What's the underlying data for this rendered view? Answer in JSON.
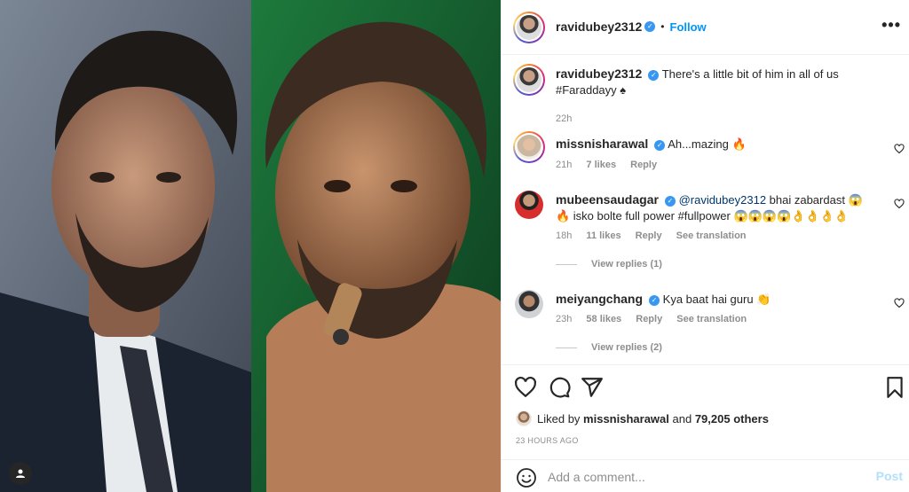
{
  "post": {
    "author": "ravidubey2312",
    "follow_label": "Follow",
    "dot": "•",
    "more_icon": "more-horizontal-icon",
    "caption_text": "There's a little bit of him in all of us #Faraddayy ♠",
    "caption_time": "22h"
  },
  "comments": [
    {
      "username": "missnisharawal",
      "verified": true,
      "text": "Ah...mazing 🔥",
      "time": "21h",
      "likes": "7 likes",
      "reply": "Reply"
    },
    {
      "username": "mubeensaudagar",
      "verified": true,
      "mention": "@ravidubey2312",
      "text": " bhai zabardast 😱 🔥 isko bolte full power #fullpower 😱😱😱😱👌👌👌👌",
      "time": "18h",
      "likes": "11 likes",
      "reply": "Reply",
      "translate": "See translation",
      "view_replies": "View replies (1)"
    },
    {
      "username": "meiyangchang",
      "verified": true,
      "text": "Kya baat hai guru 👏",
      "time": "23h",
      "likes": "58 likes",
      "reply": "Reply",
      "translate": "See translation",
      "view_replies": "View replies (2)"
    }
  ],
  "actions": {
    "liked_by_prefix": "Liked by",
    "liked_by_user": "missnisharawal",
    "liked_by_and": "and",
    "liked_by_count": "79,205 others",
    "timestamp": "23 HOURS AGO"
  },
  "composer": {
    "placeholder": "Add a comment...",
    "post_label": "Post"
  },
  "colors": {
    "accent": "#0095f6",
    "verified": "#3897f0",
    "muted": "#8e8e8e"
  }
}
